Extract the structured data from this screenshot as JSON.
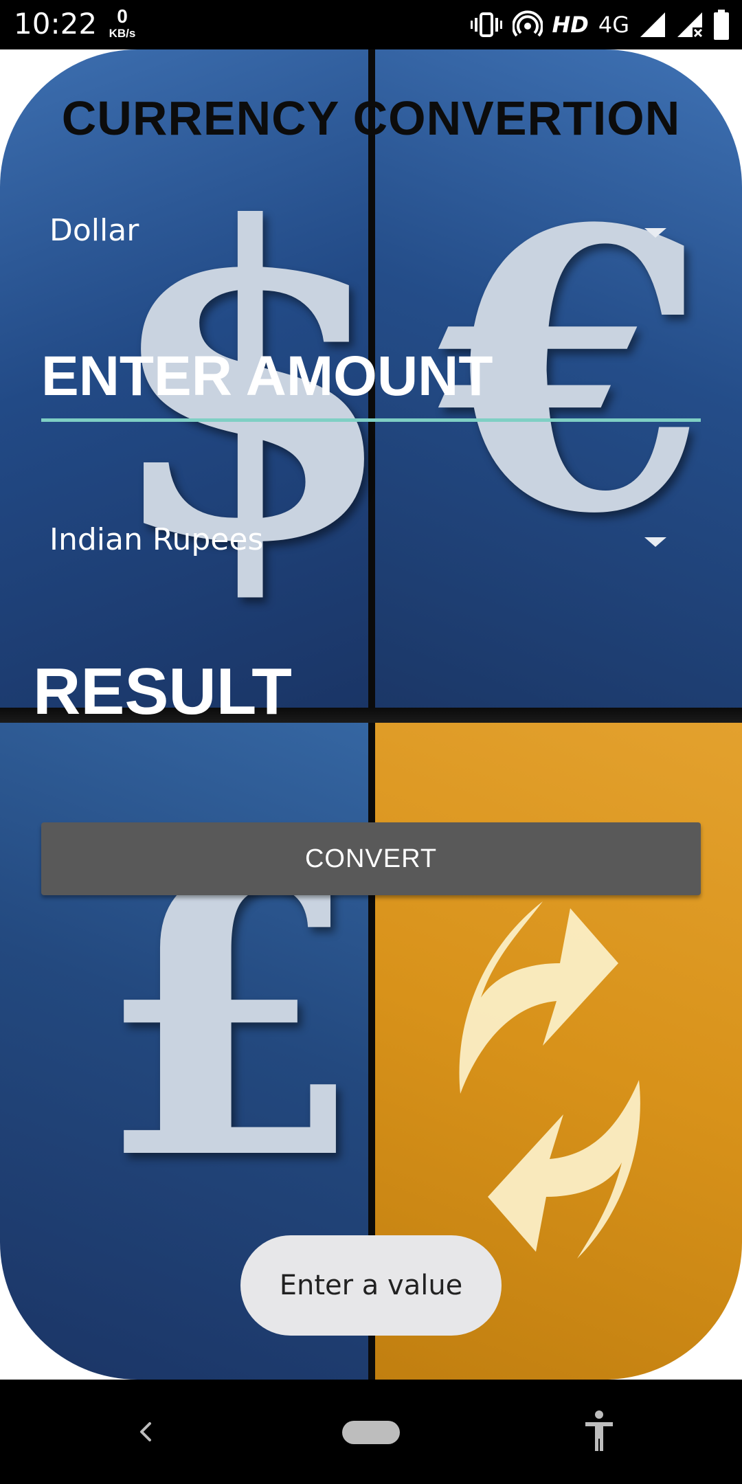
{
  "status_bar": {
    "time": "10:22",
    "net_speed_value": "0",
    "net_speed_unit": "KB/s",
    "hd_label": "HD",
    "network_label": "4G",
    "icons": [
      "vibrate-icon",
      "hotspot-icon",
      "signal-icon",
      "signal-no-data-icon",
      "battery-icon"
    ]
  },
  "app": {
    "title": "CURRENCY CONVERTION",
    "from_currency": {
      "selected": "Dollar"
    },
    "amount": {
      "value": "",
      "placeholder": "ENTER AMOUNT"
    },
    "to_currency": {
      "selected": "Indian Rupees"
    },
    "result_label": "RESULT",
    "convert_button": "CONVERT",
    "toast": "Enter a value"
  },
  "background_glyphs": {
    "dollar": "$",
    "euro": "€",
    "pound": "£"
  },
  "colors": {
    "accent_underline": "#7fcfc4",
    "button_bg": "#595959",
    "title_color": "#0c0c0c",
    "tile_blue": "#224a86",
    "tile_gold": "#d8921a"
  },
  "nav_bar": {
    "icons": [
      "back-icon",
      "home-pill-icon",
      "accessibility-icon"
    ]
  }
}
